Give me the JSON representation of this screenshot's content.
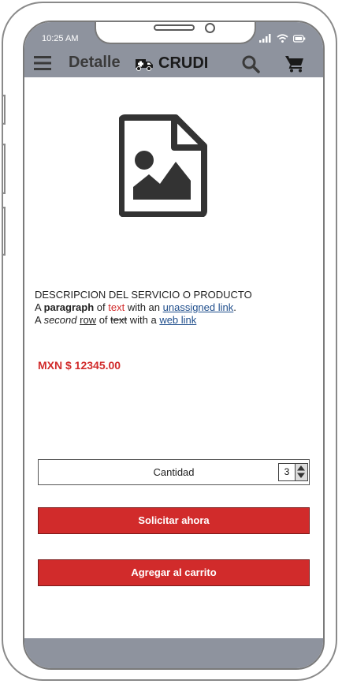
{
  "status_bar": {
    "time": "10:25 AM"
  },
  "header": {
    "title": "Detalle",
    "brand": "CRUDI",
    "bar_color": "#8e939e",
    "icons": [
      "menu-icon",
      "ambulance-icon",
      "search-icon",
      "cart-icon"
    ]
  },
  "product": {
    "image_icon": "image-file-icon",
    "heading": "DESCRIPCION DEL SERVICIO O PRODUCTO",
    "line1": {
      "t1": "A ",
      "bold": "paragraph",
      "t2": " of ",
      "red": "text",
      "t3": " with an ",
      "link": "unassigned link",
      "t4": "."
    },
    "line2": {
      "t1": "A ",
      "italic": "second",
      "t2": " ",
      "underline": "row",
      "t3": " of ",
      "strike": "text",
      "t4": " with a ",
      "link": "web link"
    },
    "price": "MXN $ 12345.00"
  },
  "quantity": {
    "label": "Cantidad",
    "value": "3"
  },
  "actions": {
    "request_label": "Solicitar ahora",
    "add_to_cart_label": "Agregar al carrito",
    "accent": "#d12b2b"
  }
}
